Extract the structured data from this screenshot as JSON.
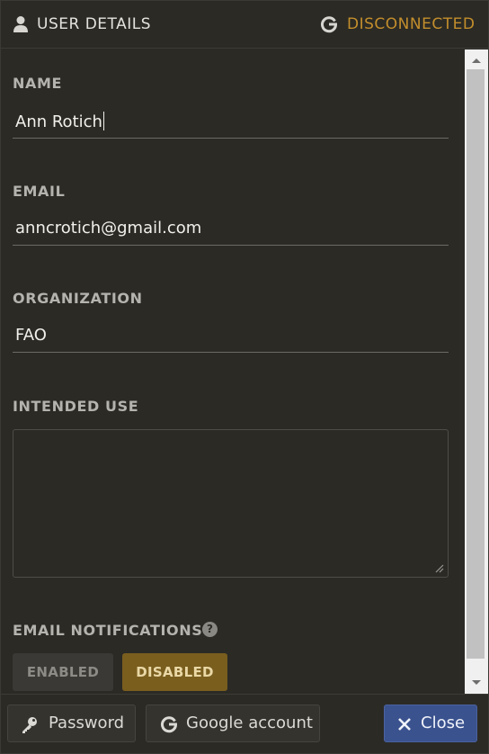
{
  "header": {
    "title": "USER DETAILS",
    "status": "DISCONNECTED",
    "status_color": "#c38e2c",
    "user_icon": "user-icon",
    "google_icon": "google-icon"
  },
  "form": {
    "name": {
      "label": "NAME",
      "value": "Ann Rotich"
    },
    "email": {
      "label": "EMAIL",
      "value": "anncrotich@gmail.com"
    },
    "organization": {
      "label": "ORGANIZATION",
      "value": "FAO"
    },
    "intended_use": {
      "label": "INTENDED USE",
      "value": ""
    },
    "email_notifications": {
      "label": "EMAIL NOTIFICATIONS",
      "help_icon": "help-icon",
      "options": [
        "ENABLED",
        "DISABLED"
      ],
      "selected": "DISABLED"
    }
  },
  "footer": {
    "password_label": "Password",
    "google_label": "Google account",
    "close_label": "Close",
    "close_color": "#3a528e"
  }
}
